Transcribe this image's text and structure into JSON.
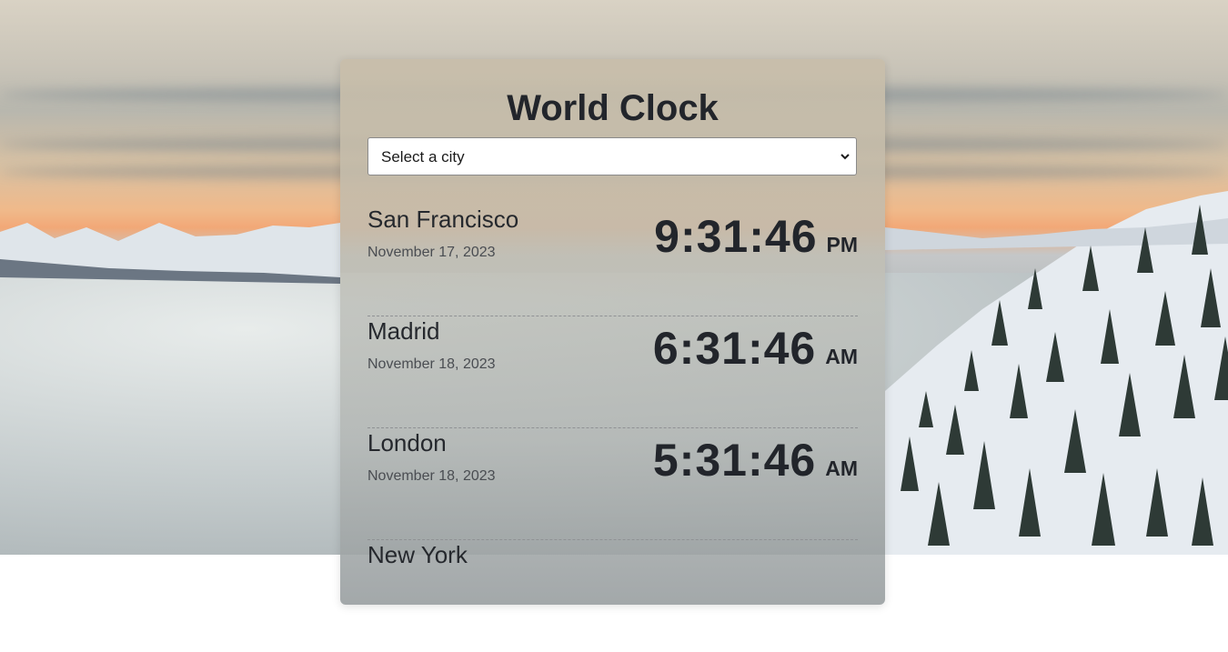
{
  "app": {
    "title": "World Clock"
  },
  "city_select": {
    "selected": "Select a city"
  },
  "clocks": [
    {
      "city": "San Francisco",
      "date": "November 17, 2023",
      "time": "9:31:46",
      "period": "PM"
    },
    {
      "city": "Madrid",
      "date": "November 18, 2023",
      "time": "6:31:46",
      "period": "AM"
    },
    {
      "city": "London",
      "date": "November 18, 2023",
      "time": "5:31:46",
      "period": "AM"
    },
    {
      "city": "New York",
      "date": "",
      "time": "",
      "period": ""
    }
  ],
  "icons": {
    "select_arrow": "chevron-down-icon"
  },
  "colors": {
    "text": "#22252b",
    "sunset": "#f2a877"
  }
}
